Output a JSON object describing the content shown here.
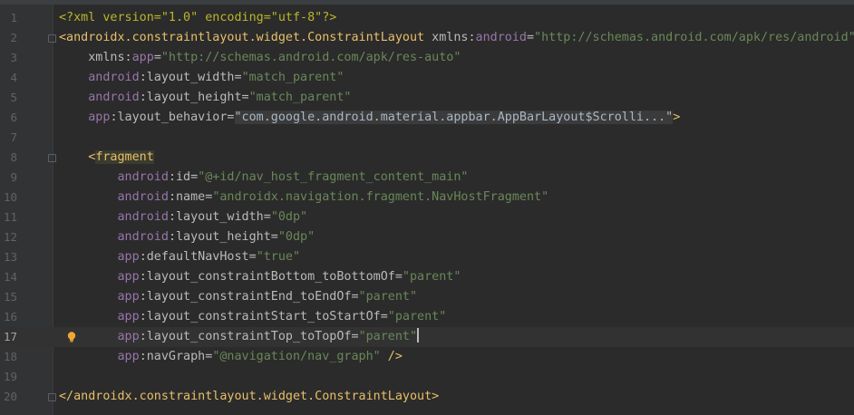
{
  "editor": {
    "lines": [
      {
        "num": "1",
        "parts": [
          [
            "t-prolog",
            "<?xml version=\"1.0\" encoding=\"utf-8\"?>"
          ]
        ]
      },
      {
        "num": "2",
        "parts": [
          [
            "t-tag",
            "<androidx.constraintlayout.widget.ConstraintLayout "
          ],
          [
            "t-attr",
            "xmlns:"
          ],
          [
            "t-ns",
            "android"
          ],
          [
            "t-attr",
            "="
          ],
          [
            "t-str",
            "\"http://schemas.android.com/apk/res/android\""
          ]
        ]
      },
      {
        "num": "3",
        "parts": [
          [
            "t-plain",
            "    "
          ],
          [
            "t-attr",
            "xmlns:"
          ],
          [
            "t-ns",
            "app"
          ],
          [
            "t-attr",
            "="
          ],
          [
            "t-str",
            "\"http://schemas.android.com/apk/res-auto\""
          ]
        ]
      },
      {
        "num": "4",
        "parts": [
          [
            "t-plain",
            "    "
          ],
          [
            "t-ns",
            "android"
          ],
          [
            "t-attr",
            ":layout_width="
          ],
          [
            "t-str",
            "\"match_parent\""
          ]
        ]
      },
      {
        "num": "5",
        "parts": [
          [
            "t-plain",
            "    "
          ],
          [
            "t-ns",
            "android"
          ],
          [
            "t-attr",
            ":layout_height="
          ],
          [
            "t-str",
            "\"match_parent\""
          ]
        ]
      },
      {
        "num": "6",
        "parts": [
          [
            "t-plain",
            "    "
          ],
          [
            "t-ns",
            "app"
          ],
          [
            "t-attr",
            ":layout_behavior="
          ],
          [
            "t-fold",
            "\"com.google.android.material.appbar.AppBarLayout$Scrolli...\""
          ],
          [
            "t-tag",
            ">"
          ]
        ]
      },
      {
        "num": "7",
        "parts": []
      },
      {
        "num": "8",
        "parts": [
          [
            "t-plain",
            "    "
          ],
          [
            "t-tag",
            "<"
          ],
          [
            "t-hl t-tag",
            "fragment"
          ]
        ]
      },
      {
        "num": "9",
        "parts": [
          [
            "t-plain",
            "        "
          ],
          [
            "t-ns",
            "android"
          ],
          [
            "t-attr",
            ":id="
          ],
          [
            "t-str",
            "\"@+id/nav_host_fragment_content_main\""
          ]
        ]
      },
      {
        "num": "10",
        "parts": [
          [
            "t-plain",
            "        "
          ],
          [
            "t-ns",
            "android"
          ],
          [
            "t-attr",
            ":name="
          ],
          [
            "t-str",
            "\"androidx.navigation.fragment.NavHostFragment\""
          ]
        ]
      },
      {
        "num": "11",
        "parts": [
          [
            "t-plain",
            "        "
          ],
          [
            "t-ns",
            "android"
          ],
          [
            "t-attr",
            ":layout_width="
          ],
          [
            "t-str",
            "\"0dp\""
          ]
        ]
      },
      {
        "num": "12",
        "parts": [
          [
            "t-plain",
            "        "
          ],
          [
            "t-ns",
            "android"
          ],
          [
            "t-attr",
            ":layout_height="
          ],
          [
            "t-str",
            "\"0dp\""
          ]
        ]
      },
      {
        "num": "13",
        "parts": [
          [
            "t-plain",
            "        "
          ],
          [
            "t-ns",
            "app"
          ],
          [
            "t-attr",
            ":defaultNavHost="
          ],
          [
            "t-str",
            "\"true\""
          ]
        ]
      },
      {
        "num": "14",
        "parts": [
          [
            "t-plain",
            "        "
          ],
          [
            "t-ns",
            "app"
          ],
          [
            "t-attr",
            ":layout_constraintBottom_toBottomOf="
          ],
          [
            "t-str",
            "\"parent\""
          ]
        ]
      },
      {
        "num": "15",
        "parts": [
          [
            "t-plain",
            "        "
          ],
          [
            "t-ns",
            "app"
          ],
          [
            "t-attr",
            ":layout_constraintEnd_toEndOf="
          ],
          [
            "t-str",
            "\"parent\""
          ]
        ]
      },
      {
        "num": "16",
        "parts": [
          [
            "t-plain",
            "        "
          ],
          [
            "t-ns",
            "app"
          ],
          [
            "t-attr",
            ":layout_constraintStart_toStartOf="
          ],
          [
            "t-str",
            "\"parent\""
          ]
        ]
      },
      {
        "num": "17",
        "parts": [
          [
            "t-plain",
            "        "
          ],
          [
            "t-ns",
            "app"
          ],
          [
            "t-attr",
            ":layout_constraintTop_toTopOf="
          ],
          [
            "t-str",
            "\"parent\""
          ],
          [
            "caret",
            ""
          ]
        ]
      },
      {
        "num": "18",
        "parts": [
          [
            "t-plain",
            "        "
          ],
          [
            "t-ns",
            "app"
          ],
          [
            "t-attr",
            ":navGraph="
          ],
          [
            "t-str",
            "\"@navigation/nav_graph\""
          ],
          [
            "t-tag",
            " />"
          ]
        ]
      },
      {
        "num": "19",
        "parts": []
      },
      {
        "num": "20",
        "parts": [
          [
            "t-tag",
            "</androidx.constraintlayout.widget.ConstraintLayout>"
          ]
        ]
      }
    ],
    "current_line": "17",
    "intention_icon": "lightbulb-icon"
  }
}
